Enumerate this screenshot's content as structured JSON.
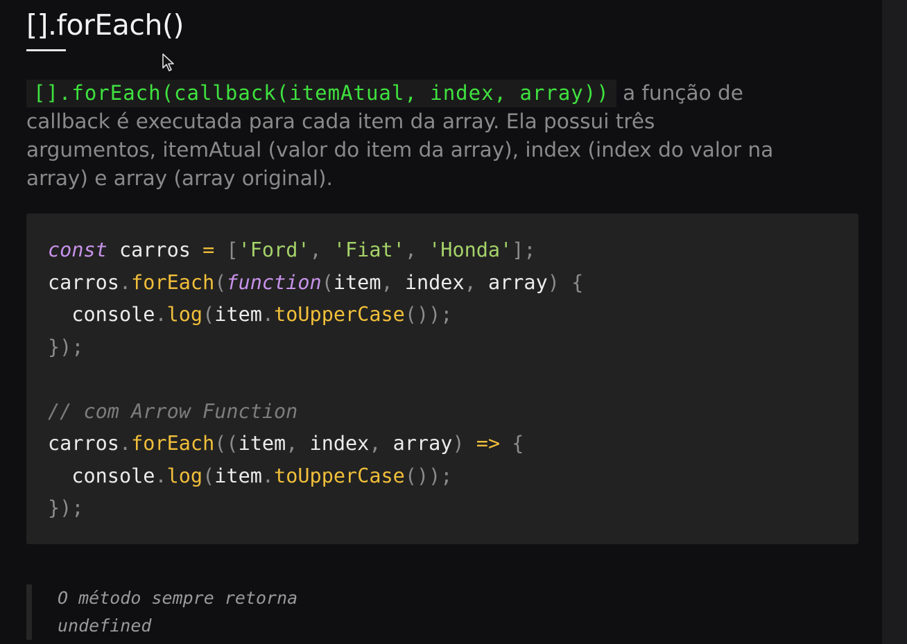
{
  "title": "[].forEach()",
  "description": {
    "code": "[].forEach(callback(itemAtual, index, array))",
    "text": " a função de callback é executada para cada item da array. Ela possui três argumentos, itemAtual (valor do item da array), index (index do valor na array) e array (array original)."
  },
  "code_lines": [
    [
      {
        "t": "const",
        "c": "kw"
      },
      {
        "t": " carros ",
        "c": "var"
      },
      {
        "t": "=",
        "c": "op"
      },
      {
        "t": " [",
        "c": "punc"
      },
      {
        "t": "'Ford'",
        "c": "str"
      },
      {
        "t": ", ",
        "c": "punc"
      },
      {
        "t": "'Fiat'",
        "c": "str"
      },
      {
        "t": ", ",
        "c": "punc"
      },
      {
        "t": "'Honda'",
        "c": "str"
      },
      {
        "t": "];",
        "c": "punc"
      }
    ],
    [
      {
        "t": "carros",
        "c": "var"
      },
      {
        "t": ".",
        "c": "punc"
      },
      {
        "t": "forEach",
        "c": "fn"
      },
      {
        "t": "(",
        "c": "punc"
      },
      {
        "t": "function",
        "c": "kw"
      },
      {
        "t": "(",
        "c": "punc"
      },
      {
        "t": "item",
        "c": "var"
      },
      {
        "t": ", ",
        "c": "punc"
      },
      {
        "t": "index",
        "c": "var"
      },
      {
        "t": ", ",
        "c": "punc"
      },
      {
        "t": "array",
        "c": "var"
      },
      {
        "t": ") {",
        "c": "punc"
      }
    ],
    [
      {
        "t": "  console",
        "c": "var"
      },
      {
        "t": ".",
        "c": "punc"
      },
      {
        "t": "log",
        "c": "fn"
      },
      {
        "t": "(",
        "c": "punc"
      },
      {
        "t": "item",
        "c": "var"
      },
      {
        "t": ".",
        "c": "punc"
      },
      {
        "t": "toUpperCase",
        "c": "fn"
      },
      {
        "t": "());",
        "c": "punc"
      }
    ],
    [
      {
        "t": "});",
        "c": "punc"
      }
    ],
    [],
    [
      {
        "t": "// com Arrow Function",
        "c": "cmt"
      }
    ],
    [
      {
        "t": "carros",
        "c": "var"
      },
      {
        "t": ".",
        "c": "punc"
      },
      {
        "t": "forEach",
        "c": "fn"
      },
      {
        "t": "((",
        "c": "punc"
      },
      {
        "t": "item",
        "c": "var"
      },
      {
        "t": ", ",
        "c": "punc"
      },
      {
        "t": "index",
        "c": "var"
      },
      {
        "t": ", ",
        "c": "punc"
      },
      {
        "t": "array",
        "c": "var"
      },
      {
        "t": ") ",
        "c": "punc"
      },
      {
        "t": "=>",
        "c": "op"
      },
      {
        "t": " {",
        "c": "punc"
      }
    ],
    [
      {
        "t": "  console",
        "c": "var"
      },
      {
        "t": ".",
        "c": "punc"
      },
      {
        "t": "log",
        "c": "fn"
      },
      {
        "t": "(",
        "c": "punc"
      },
      {
        "t": "item",
        "c": "var"
      },
      {
        "t": ".",
        "c": "punc"
      },
      {
        "t": "toUpperCase",
        "c": "fn"
      },
      {
        "t": "());",
        "c": "punc"
      }
    ],
    [
      {
        "t": "});",
        "c": "punc"
      }
    ]
  ],
  "note": "O método sempre retorna undefined",
  "colors": {
    "background": "#0f0f12",
    "inline_code": "#3fe23f",
    "keyword": "#c792ea",
    "string": "#a5d36a",
    "function": "#f1bf3a",
    "comment": "#7d7d7d"
  },
  "icons": {
    "cursor": "mouse-pointer-icon"
  }
}
